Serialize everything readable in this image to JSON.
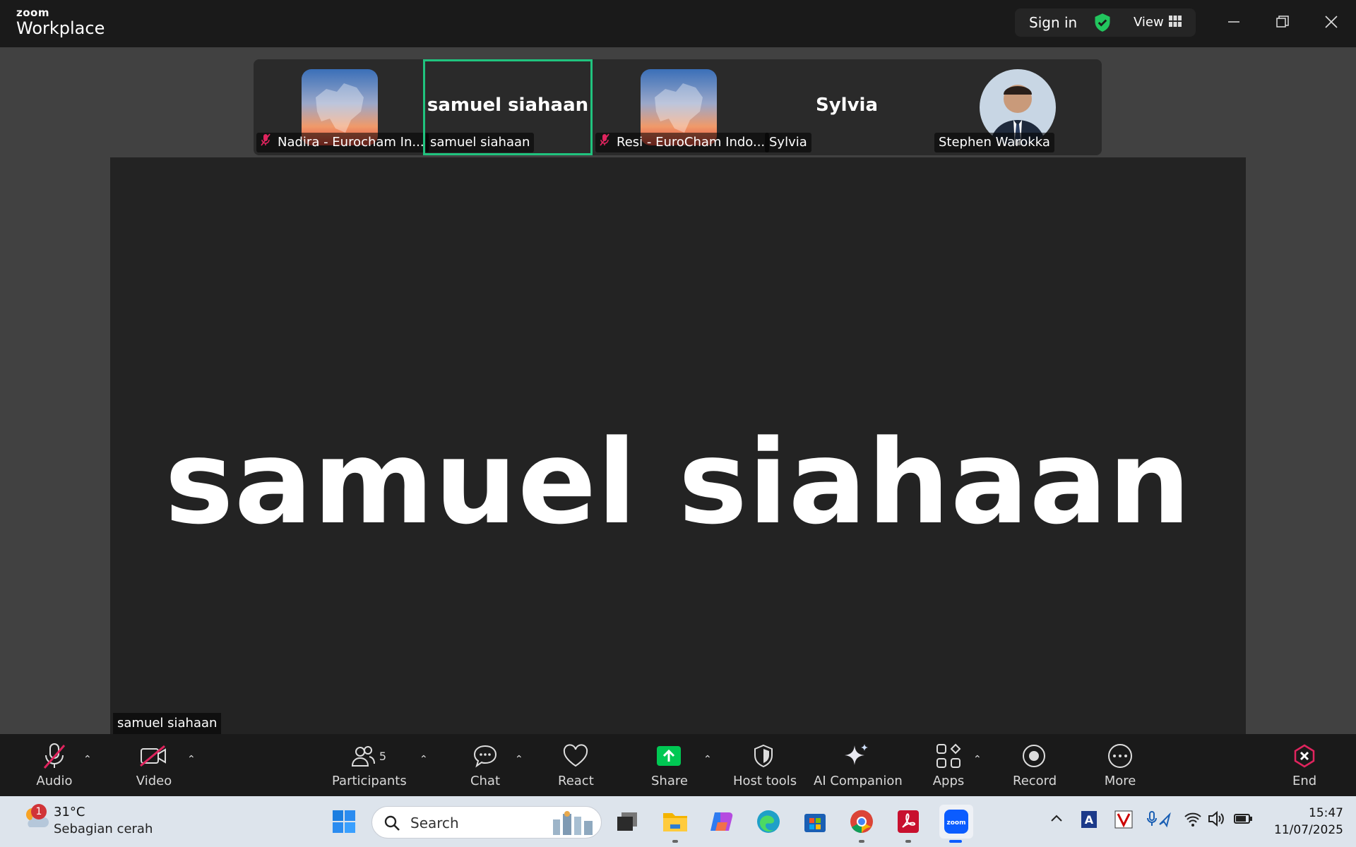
{
  "app": {
    "brand_top": "zoom",
    "brand_bottom": "Workplace"
  },
  "titlebar": {
    "sign_in": "Sign in",
    "view": "View"
  },
  "strip": {
    "participants": [
      {
        "name": "Nadira - Eurocham In...",
        "muted": true,
        "type": "image"
      },
      {
        "name": "samuel siahaan",
        "muted": false,
        "type": "text",
        "display": "samuel siahaan",
        "active": true
      },
      {
        "name": "Resi - EuroCham Indo...",
        "muted": true,
        "type": "image"
      },
      {
        "name": "Sylvia",
        "muted": false,
        "type": "text",
        "display": "Sylvia"
      },
      {
        "name": "Stephen Warokka",
        "muted": false,
        "type": "photo"
      }
    ]
  },
  "main": {
    "speaker_display": "samuel siahaan",
    "speaker_label": "samuel siahaan"
  },
  "toolbar": {
    "audio": "Audio",
    "video": "Video",
    "participants": "Participants",
    "participants_count": "5",
    "chat": "Chat",
    "react": "React",
    "share": "Share",
    "host_tools": "Host tools",
    "ai_companion": "AI Companion",
    "apps": "Apps",
    "record": "Record",
    "more": "More",
    "end": "End"
  },
  "taskbar": {
    "weather_temp": "31°C",
    "weather_desc": "Sebagian cerah",
    "weather_badge": "1",
    "search_placeholder": "Search",
    "time": "15:47",
    "date": "11/07/2025"
  },
  "colors": {
    "accent_green": "#20c37e",
    "share_green": "#00c853",
    "mute_red": "#e0245e"
  }
}
